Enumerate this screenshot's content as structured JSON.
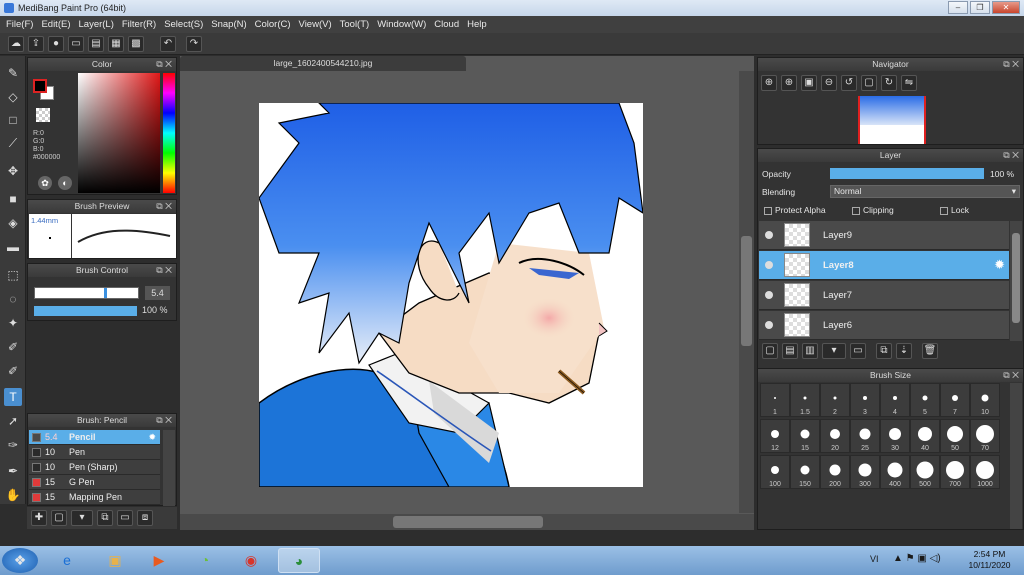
{
  "window": {
    "title": "MediBang Paint Pro (64bit)",
    "min_label": "–",
    "max_label": "❐",
    "close_label": "✕"
  },
  "menu": [
    "File(F)",
    "Edit(E)",
    "Layer(L)",
    "Filter(R)",
    "Select(S)",
    "Snap(N)",
    "Color(C)",
    "View(V)",
    "Tool(T)",
    "Window(W)",
    "Cloud",
    "Help"
  ],
  "toolbar_icons": [
    "cloud-icon",
    "upload-icon",
    "comment-icon",
    "chat-icon",
    "page-icon",
    "gallery-icon",
    "grid-icon",
    "undo-icon",
    "redo-icon"
  ],
  "color_panel": {
    "title": "Color",
    "r": "R:0",
    "g": "G:0",
    "b": "B:0",
    "hex": "#000000",
    "fg": "#000000",
    "bg": "#ffffff"
  },
  "brush_preview": {
    "title": "Brush Preview",
    "size": "1.44mm"
  },
  "brush_control": {
    "title": "Brush Control",
    "size_value": "5.4",
    "opacity_value": "100 %",
    "size_fill": 0.7,
    "opacity_fill": 1.0
  },
  "brush_list": {
    "title": "Brush: Pencil",
    "items": [
      {
        "value": "5.4",
        "name": "Pencil",
        "color": "#4a4a4a",
        "selected": true
      },
      {
        "value": "10",
        "name": "Pen",
        "color": "#2a2a2a",
        "selected": false
      },
      {
        "value": "10",
        "name": "Pen (Sharp)",
        "color": "#2a2a2a",
        "selected": false
      },
      {
        "value": "15",
        "name": "G Pen",
        "color": "#e03a3a",
        "selected": false
      },
      {
        "value": "15",
        "name": "Mapping Pen",
        "color": "#e03a3a",
        "selected": false
      }
    ]
  },
  "document": {
    "tab": "large_1602400544210.jpg"
  },
  "navigator": {
    "title": "Navigator"
  },
  "layer_panel": {
    "title": "Layer",
    "opacity_label": "Opacity",
    "opacity_value": "100 %",
    "opacity_fill": 1.0,
    "blending_label": "Blending",
    "blending_value": "Normal",
    "protect_alpha": "Protect Alpha",
    "clipping": "Clipping",
    "lock": "Lock",
    "layers": [
      {
        "name": "Layer9",
        "selected": false
      },
      {
        "name": "Layer8",
        "selected": true
      },
      {
        "name": "Layer7",
        "selected": false
      },
      {
        "name": "Layer6",
        "selected": false
      }
    ]
  },
  "brush_size": {
    "title": "Brush Size",
    "sizes": [
      "1",
      "1.5",
      "2",
      "3",
      "4",
      "5",
      "7",
      "10",
      "12",
      "15",
      "20",
      "25",
      "30",
      "40",
      "50",
      "70",
      "100",
      "150",
      "200",
      "300",
      "400",
      "500",
      "700",
      "1000"
    ]
  },
  "taskbar": {
    "lang": "VI",
    "time": "2:54 PM",
    "date": "10/11/2020"
  }
}
